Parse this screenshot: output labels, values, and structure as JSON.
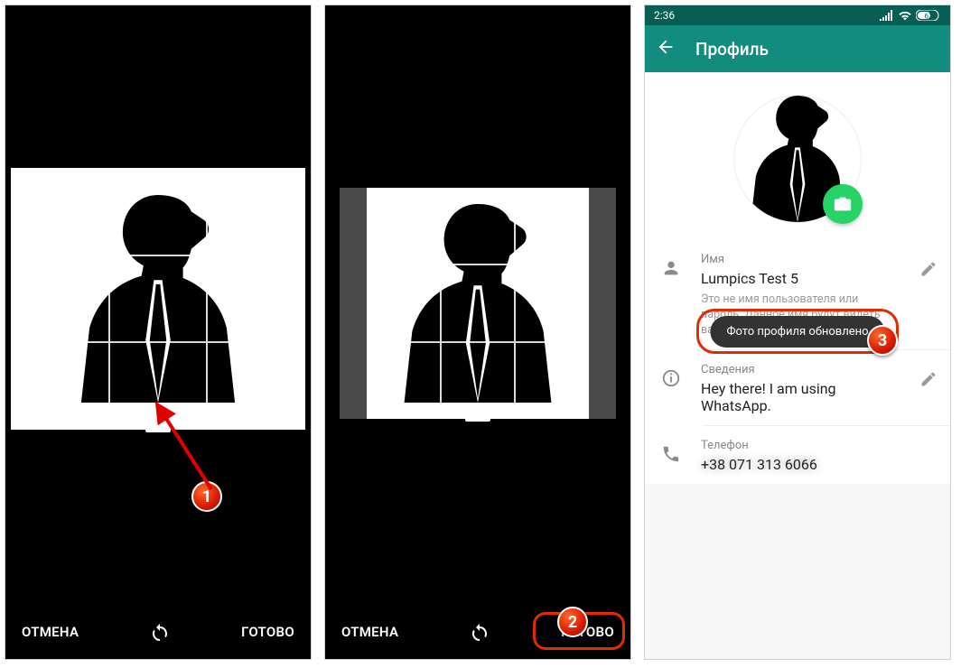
{
  "cropper": {
    "cancel": "ОТМЕНА",
    "done": "ГОТОВО"
  },
  "statusbar": {
    "time": "2:36",
    "battery": "61"
  },
  "appbar": {
    "title": "Профиль"
  },
  "profile": {
    "name_label": "Имя",
    "name_value": "Lumpics Test 5",
    "name_hint": "Это не имя пользователя или пароль. Данное имя будут видеть ваши контакты в WhatsApp.",
    "about_label": "Сведения",
    "about_value": "Hey there! I am using WhatsApp.",
    "phone_label": "Телефон",
    "phone_value": "+38 071 313 6066"
  },
  "toast": "Фото профиля обновлено",
  "badges": {
    "n1": "1",
    "n2": "2",
    "n3": "3"
  }
}
